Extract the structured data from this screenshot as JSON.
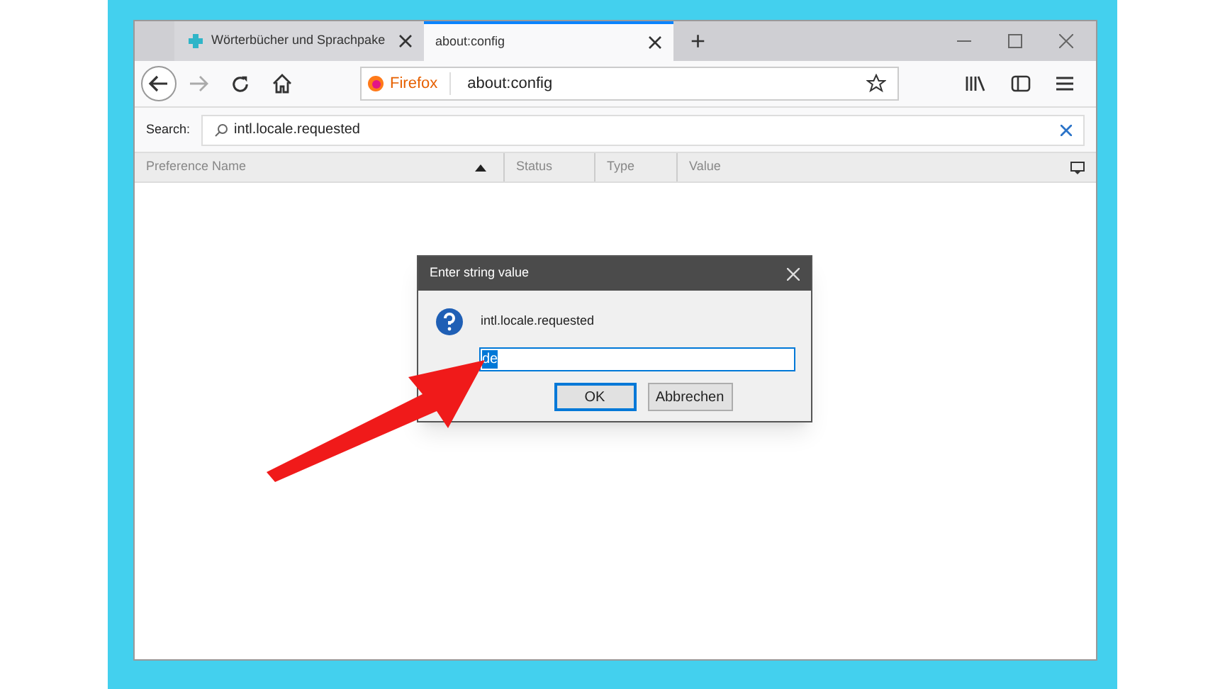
{
  "tabs": [
    {
      "label": "Wörterbücher und Sprachpake",
      "selected": false
    },
    {
      "label": "about:config",
      "selected": true
    }
  ],
  "new_tab": "+",
  "url_bar": {
    "identity": "Firefox",
    "url": "about:config"
  },
  "search": {
    "label": "Search:",
    "value": "intl.locale.requested"
  },
  "table": {
    "columns": [
      "Preference Name",
      "Status",
      "Type",
      "Value"
    ]
  },
  "dialog": {
    "title": "Enter string value",
    "prompt": "intl.locale.requested",
    "value": "de",
    "buttons": [
      "OK",
      "Abbrechen"
    ]
  }
}
